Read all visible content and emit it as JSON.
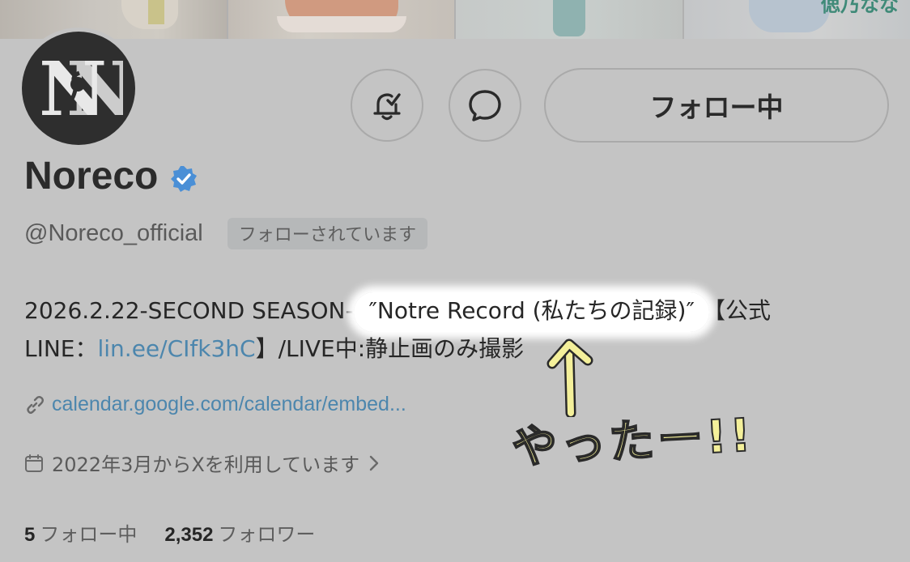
{
  "banner": {
    "overlay_text": "偲乃なな"
  },
  "profile": {
    "avatar_icon": "noreco-logo",
    "display_name": "Noreco",
    "verified": true,
    "handle": "@Noreco_official",
    "follows_you_badge": "フォローされています"
  },
  "actions": {
    "notify_icon": "bell-check-icon",
    "message_icon": "chat-bubble-icon",
    "follow_button_label": "フォロー中"
  },
  "bio": {
    "line1_prefix": "2026.2.22-SECOND SEASON- ",
    "line1_highlight": "″Notre Record (私たちの記録)″",
    "line1_suffix": "【公式",
    "line2_prefix": "LINE：",
    "line2_link": "lin.ee/CIfk3hC",
    "line2_suffix": "】/LIVE中:静止画のみ撮影"
  },
  "website": {
    "icon": "link-icon",
    "url_text": "calendar.google.com/calendar/embed..."
  },
  "joined": {
    "icon": "calendar-icon",
    "text": "2022年3月からXを利用しています"
  },
  "stats": {
    "following_count": "5",
    "following_label": "フォロー中",
    "followers_count": "2,352",
    "followers_label": "フォロワー"
  },
  "annotation": {
    "handwritten_text": "やったー!!"
  },
  "colors": {
    "background": "#c4c4c4",
    "link": "#4c86ad",
    "verified": "#4a8fd6",
    "highlight": "#ffffff",
    "doodle": "#f4f09a"
  }
}
